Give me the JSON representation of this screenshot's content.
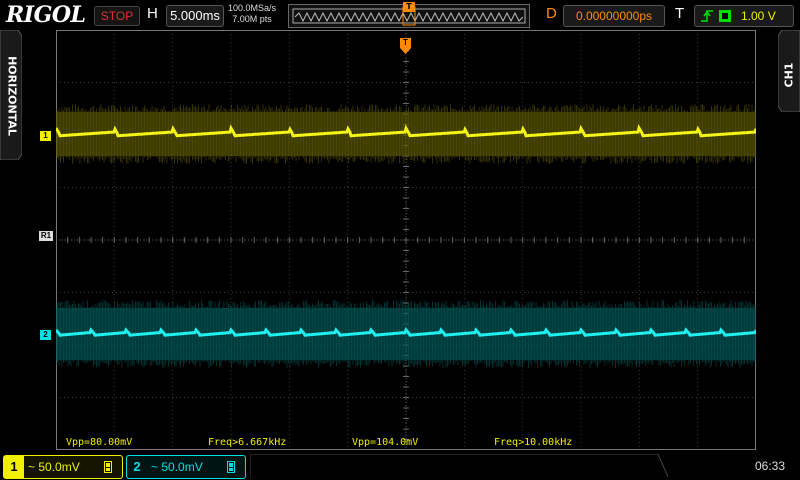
{
  "header": {
    "brand": "RIGOL",
    "run_state": "STOP",
    "horizontal_label": "H",
    "timebase": "5.000ms",
    "sample_rate": "100.0MSa/s",
    "memory_depth": "7.00M pts",
    "delay_label": "D",
    "trigger_position": "0.00000000ps",
    "trigger_label": "T",
    "trigger_level": "1.00 V"
  },
  "side": {
    "left_tab": "HORIZONTAL",
    "right_tab": "CH1"
  },
  "markers": {
    "ch1": "1",
    "ch2": "2",
    "ref": "R1",
    "trigger": "T"
  },
  "measurements": [
    {
      "text": "Vpp=80.00mV",
      "color": "#f0f000"
    },
    {
      "text": "Freq>6.667kHz",
      "color": "#f0f000"
    },
    {
      "text": "Vpp=104.0mV",
      "color": "#f0f000"
    },
    {
      "text": "Freq>10.00kHz",
      "color": "#f0f000"
    }
  ],
  "channels": [
    {
      "number": "1",
      "scale": "~ 50.0mV",
      "color": "#f0f000"
    },
    {
      "number": "2",
      "scale": "~ 50.0mV",
      "color": "#00e0e0"
    }
  ],
  "clock": "06:33",
  "colors": {
    "ch1": "#f0f000",
    "ch2": "#00e0e0",
    "accent": "#ff8c00",
    "stop": "#e03030"
  }
}
